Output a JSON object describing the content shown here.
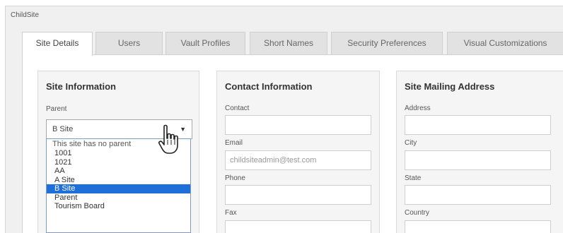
{
  "window": {
    "title": "ChildSite"
  },
  "tabs": [
    {
      "label": "Site Details",
      "active": true
    },
    {
      "label": "Users"
    },
    {
      "label": "Vault Profiles"
    },
    {
      "label": "Short Names"
    },
    {
      "label": "Security Preferences"
    },
    {
      "label": "Visual Customizations"
    }
  ],
  "site_information": {
    "title": "Site Information",
    "parent_label": "Parent",
    "parent_value": "B Site",
    "parent_options": [
      "This site has no parent",
      "1001",
      "1021",
      "AA",
      "A Site",
      "B Site",
      "Parent",
      "Tourism Board"
    ],
    "selected_option": "B Site"
  },
  "contact_information": {
    "title": "Contact Information",
    "contact_label": "Contact",
    "contact_value": "",
    "email_label": "Email",
    "email_placeholder": "childsiteadmin@test.com",
    "phone_label": "Phone",
    "phone_value": "",
    "fax_label": "Fax",
    "fax_value": ""
  },
  "mailing_address": {
    "title": "Site Mailing Address",
    "address_label": "Address",
    "city_label": "City",
    "state_label": "State",
    "country_label": "Country"
  },
  "icons": {
    "select_arrow": "chevron-down-icon",
    "cursor": "hand-pointer-icon"
  }
}
